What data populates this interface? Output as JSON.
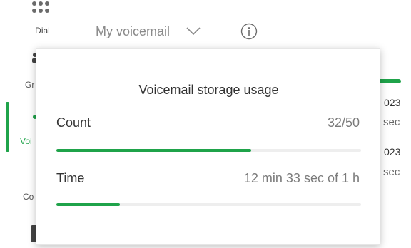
{
  "nav": {
    "dial": {
      "label": "Dial",
      "icon": "dial-pad-icon"
    },
    "partials": [
      {
        "id": "groups",
        "text": "Gr"
      },
      {
        "id": "voicemail",
        "text": "Voi"
      },
      {
        "id": "contacts",
        "text": "Co"
      }
    ]
  },
  "header": {
    "mailbox_select": "My voicemail",
    "info_icon": "info-icon"
  },
  "background_list": {
    "rows": [
      {
        "date": "023",
        "duration": "sec"
      },
      {
        "date": "023",
        "duration": "sec"
      }
    ]
  },
  "storage_popover": {
    "title": "Voicemail storage usage",
    "count": {
      "label": "Count",
      "value": "32/50",
      "fraction": 0.64
    },
    "time": {
      "label": "Time",
      "value": "12 min 33 sec of 1 h",
      "fraction": 0.209
    }
  },
  "colors": {
    "accent": "#1fa34a",
    "track": "#eeeeee"
  }
}
